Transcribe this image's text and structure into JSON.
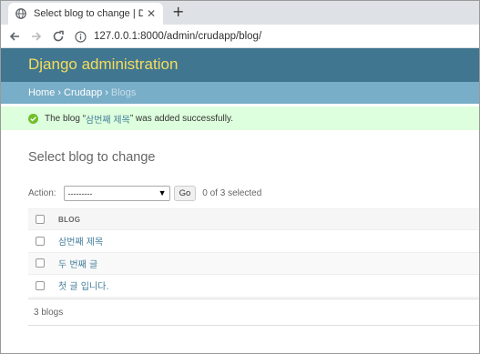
{
  "browser": {
    "tab_title": "Select blog to change | Django",
    "url": "127.0.0.1:8000/admin/crudapp/blog/"
  },
  "header": {
    "branding": "Django administration"
  },
  "breadcrumbs": {
    "home": "Home",
    "app": "Crudapp",
    "current": "Blogs",
    "separator": "›"
  },
  "message": {
    "prefix": "The blog “",
    "name": "삼번째 제목",
    "suffix": "” was added successfully."
  },
  "content": {
    "title": "Select blog to change"
  },
  "actions": {
    "label": "Action:",
    "selected_option": "---------",
    "go_label": "Go",
    "counter": "0 of 3 selected"
  },
  "table": {
    "column_header": "BLOG",
    "rows": [
      {
        "title": "삼번째 제목"
      },
      {
        "title": "두 번째 글"
      },
      {
        "title": "첫 글 입니다."
      }
    ]
  },
  "paginator": {
    "count": "3 blogs"
  },
  "colors": {
    "header_bg": "#417690",
    "branding": "#f5dd5d",
    "breadcrumbs_bg": "#79aec8",
    "success_bg": "#dfd",
    "link": "#447e9b"
  }
}
